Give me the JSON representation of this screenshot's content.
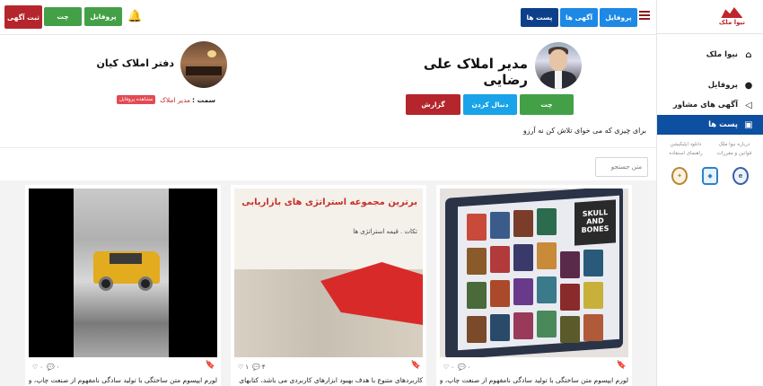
{
  "sidebar": {
    "logo_text": "نیوا ملک",
    "items": [
      {
        "label": "نیوا ملک",
        "icon": "home-icon"
      },
      {
        "label": "پروفایل",
        "icon": "user-icon"
      },
      {
        "label": "آگهی های مشاور",
        "icon": "megaphone-icon"
      },
      {
        "label": "پست ها",
        "icon": "image-icon"
      }
    ],
    "links": [
      "درباره نیوا ملک",
      "دانلود اپلیکیشن",
      "قوانین و مقررات",
      "راهنمای استفاده"
    ]
  },
  "header": {
    "nav": {
      "profile": "پروفایل",
      "ads": "آگهی ها",
      "posts": "پست ها"
    },
    "actions": {
      "profile": "پروفایل",
      "chat": "چت",
      "post_ad": "ثبت آگهی"
    }
  },
  "profile": {
    "name": "مدیر املاک علی رضایی",
    "office": "دفتر املاک کیان",
    "role_label": "سمت :",
    "role_value": "مدیر املاک",
    "view_profile": "مشاهده پروفایل",
    "buttons": {
      "chat": "چت",
      "follow": "دنبال کردن",
      "report": "گزارش"
    },
    "bio": "برای چیزی که می خوای تلاش کن نه آرزو"
  },
  "search": {
    "placeholder": "متن جستجو"
  },
  "posts": [
    {
      "likes": "۰",
      "comments": "۰",
      "caption": "لورم ایپسوم متن ساختگی با تولید سادگی نامفهوم از صنعت چاپ، و با"
    },
    {
      "likes": "۱",
      "comments": "۴",
      "caption": "کاربردهای متنوع با هدف بهبود ابزارهای کاربردی می باشد، کتابهای"
    },
    {
      "likes": "۰",
      "comments": "۰",
      "caption": "لورم ایپسوم متن ساختگی با تولید سادگی نامفهوم از صنعت چاپ، و با"
    }
  ],
  "thumb_texts": {
    "book_title": "برترین مجموعه استراتژی های بازاریابی",
    "book_sub": "تکات . قیمه استراتژی ها",
    "movie_title": "SKULL AND BONES"
  },
  "colors": {
    "primary": "#0d4fa0",
    "accent_blue": "#1e88e5",
    "green": "#43a047",
    "dark_red": "#b5262c",
    "cyan": "#1aa3e8"
  }
}
